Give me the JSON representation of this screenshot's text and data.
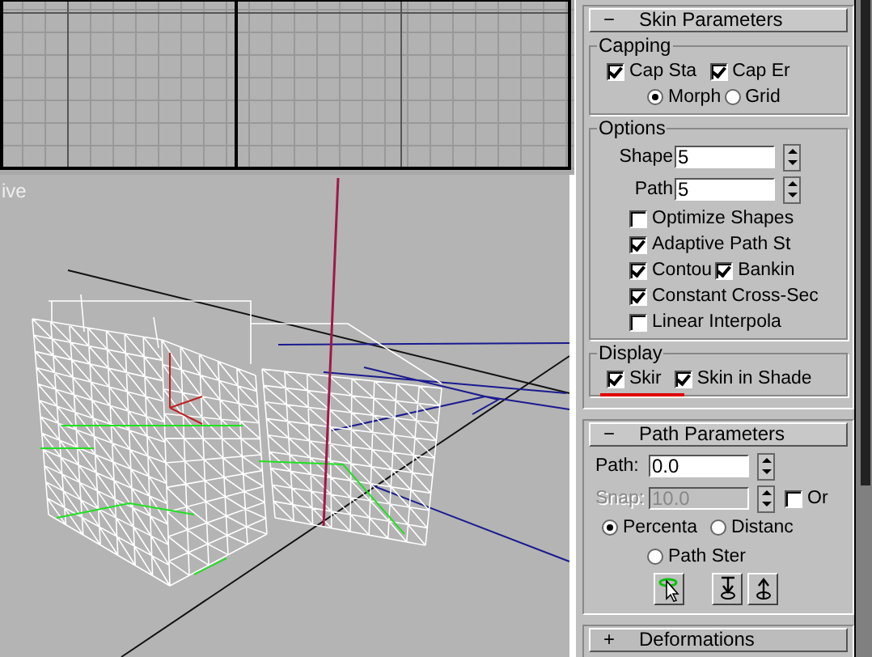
{
  "viewport": {
    "label": "ive"
  },
  "skin_parameters": {
    "sign": "−",
    "title": "Skin Parameters",
    "expanded": true,
    "capping": {
      "title": "Capping",
      "checkboxes": [
        {
          "label": "Cap Sta",
          "checked": true
        },
        {
          "label": "Cap Er",
          "checked": true
        }
      ],
      "radios": [
        {
          "label": "Morph",
          "selected": true
        },
        {
          "label": "Grid",
          "selected": false
        }
      ]
    },
    "options": {
      "title": "Options",
      "spinners": [
        {
          "label": "Shape",
          "value": "5"
        },
        {
          "label": "Path",
          "value": "5"
        }
      ],
      "rows": [
        [
          {
            "label": "Optimize Shapes",
            "checked": false
          }
        ],
        [
          {
            "label": "Adaptive Path St",
            "checked": true
          }
        ],
        [
          {
            "label": "Contou",
            "checked": true
          },
          {
            "label": "Bankin",
            "checked": true
          }
        ],
        [
          {
            "label": "Constant Cross-Sec",
            "checked": true
          }
        ],
        [
          {
            "label": "Linear Interpola",
            "checked": false
          }
        ]
      ]
    },
    "display": {
      "title": "Display",
      "checkboxes": [
        {
          "label": "Skir",
          "checked": true,
          "underlined": true
        },
        {
          "label": "Skin in Shade",
          "checked": true,
          "underlined": false
        }
      ]
    }
  },
  "path_parameters": {
    "sign": "−",
    "title": "Path Parameters",
    "expanded": true,
    "path": {
      "label": "Path:",
      "value": "0.0",
      "disabled": false
    },
    "snap": {
      "label": "Snap:",
      "value": "10.0",
      "disabled": true
    },
    "on": {
      "label": "Or",
      "checked": false
    },
    "radios": [
      {
        "label": "Percenta",
        "selected": true
      },
      {
        "label": "Distanc",
        "selected": false
      },
      {
        "label": "Path Ster",
        "selected": false
      }
    ],
    "tools": [
      {
        "kind": "pick"
      },
      {
        "kind": "prev"
      },
      {
        "kind": "next"
      }
    ]
  },
  "deformations": {
    "sign": "+",
    "title": "Deformations",
    "expanded": false
  }
}
